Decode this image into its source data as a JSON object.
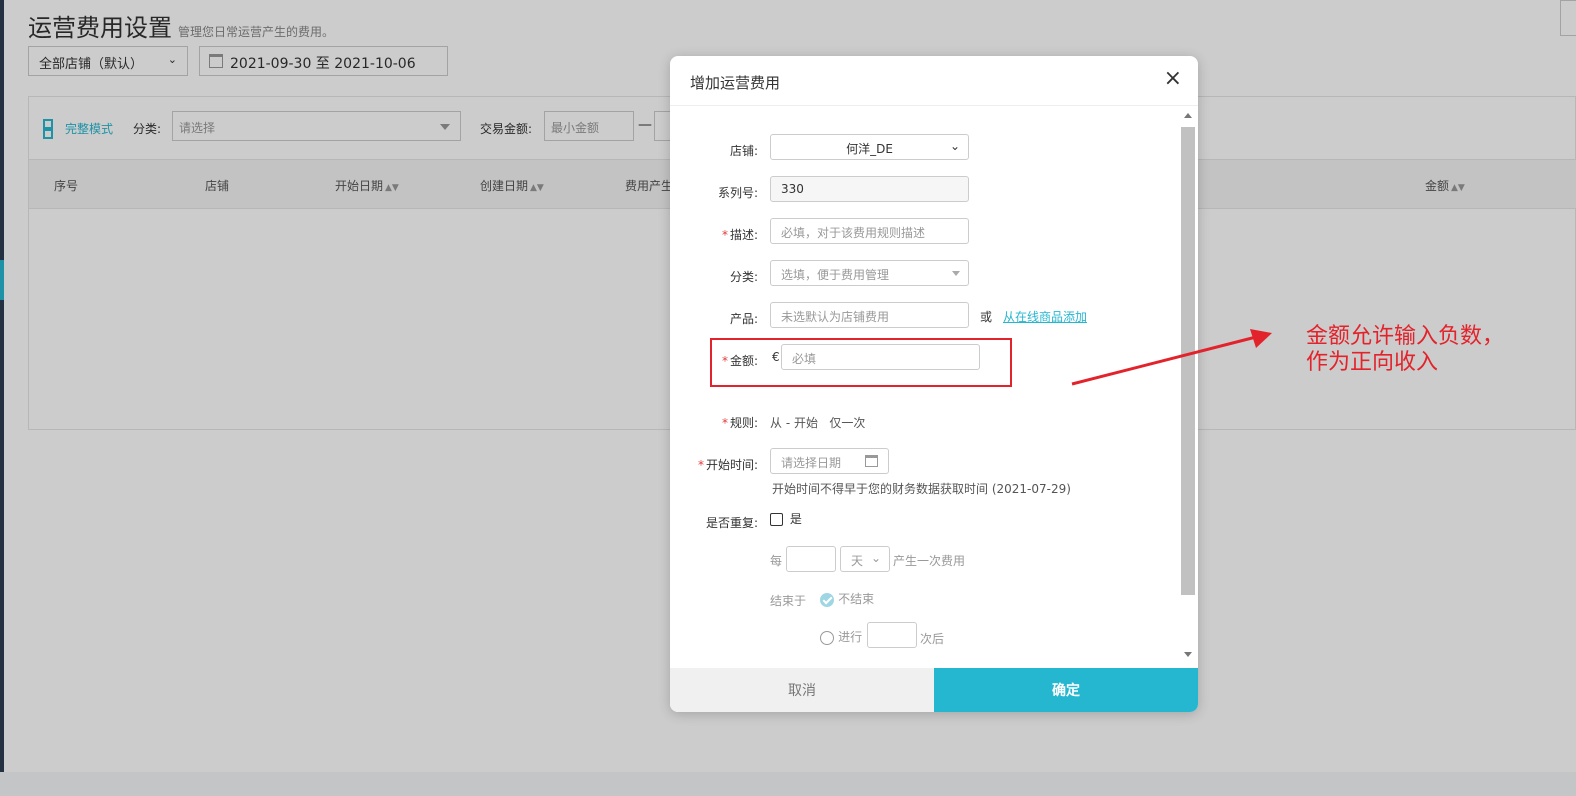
{
  "page": {
    "title": "运营费用设置",
    "subtitle": "管理您日常运营产生的费用。",
    "store_select": "全部店铺（默认）",
    "date_range": "2021-09-30 至 2021-10-06"
  },
  "filters": {
    "mode_label": "完整模式",
    "category_label": "分类:",
    "category_placeholder": "请选择",
    "amount_label": "交易金额:",
    "min_placeholder": "最小金额",
    "dash": "—"
  },
  "table": {
    "columns": [
      "序号",
      "店铺",
      "开始日期",
      "创建日期",
      "费用产生",
      "金额"
    ],
    "sort_glyph": "▲▼"
  },
  "modal": {
    "title": "增加运营费用",
    "close_glyph": "×",
    "store": {
      "label": "店铺:",
      "value": "何洋_DE",
      "chevron": "⌄"
    },
    "serial": {
      "label": "系列号:",
      "value": "330"
    },
    "description": {
      "required": "*",
      "label": "描述:",
      "placeholder": "必填，对于该费用规则描述"
    },
    "category": {
      "label": "分类:",
      "placeholder": "选填，便于费用管理"
    },
    "product": {
      "label": "产品:",
      "placeholder": "未选默认为店铺费用",
      "or": "或",
      "link": "从在线商品添加"
    },
    "amount": {
      "required": "*",
      "label": "金额:",
      "currency": "€",
      "placeholder": "必填"
    },
    "rule": {
      "required": "*",
      "label": "规则:",
      "value": "从 - 开始   仅一次"
    },
    "start_time": {
      "required": "*",
      "label": "开始时间:",
      "placeholder": "请选择日期",
      "hint": "开始时间不得早于您的财务数据获取时间 (2021-07-29)"
    },
    "repeat": {
      "label": "是否重复:",
      "option": "是"
    },
    "every": {
      "prefix": "每",
      "unit": "天",
      "suffix": "产生一次费用"
    },
    "end": {
      "label": "结束于",
      "option_never": "不结束",
      "option_after_prefix": "进行",
      "option_after_suffix": "次后"
    },
    "cancel_label": "取消",
    "ok_label": "确定"
  },
  "annotation": {
    "line1": "金额允许输入负数，",
    "line2": "作为正向收入"
  },
  "colors": {
    "accent": "#26b7d0",
    "annotation_red": "#e3232b"
  }
}
